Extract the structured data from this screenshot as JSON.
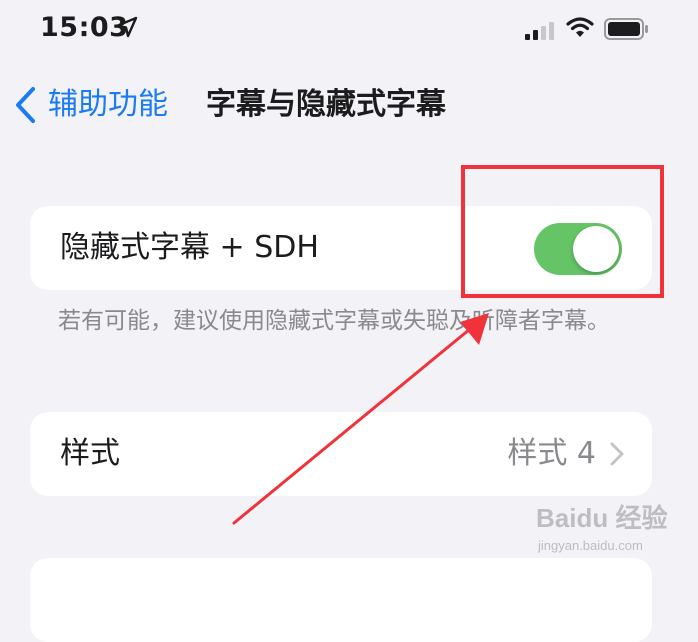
{
  "status_bar": {
    "time": "15:03"
  },
  "nav": {
    "back_label": "辅助功能",
    "title": "字幕与隐藏式字幕"
  },
  "cc_row": {
    "label": "隐藏式字幕 + SDH",
    "toggle_on": true,
    "toggle_color": "#65c466"
  },
  "footnote": "若有可能，建议使用隐藏式字幕或失聪及听障者字幕。",
  "style_row": {
    "label": "样式",
    "value": "样式 4"
  },
  "annotation_color": "#f0333b",
  "watermark": {
    "brand": "Baidu 经验",
    "site": "jingyan.baidu.com"
  }
}
